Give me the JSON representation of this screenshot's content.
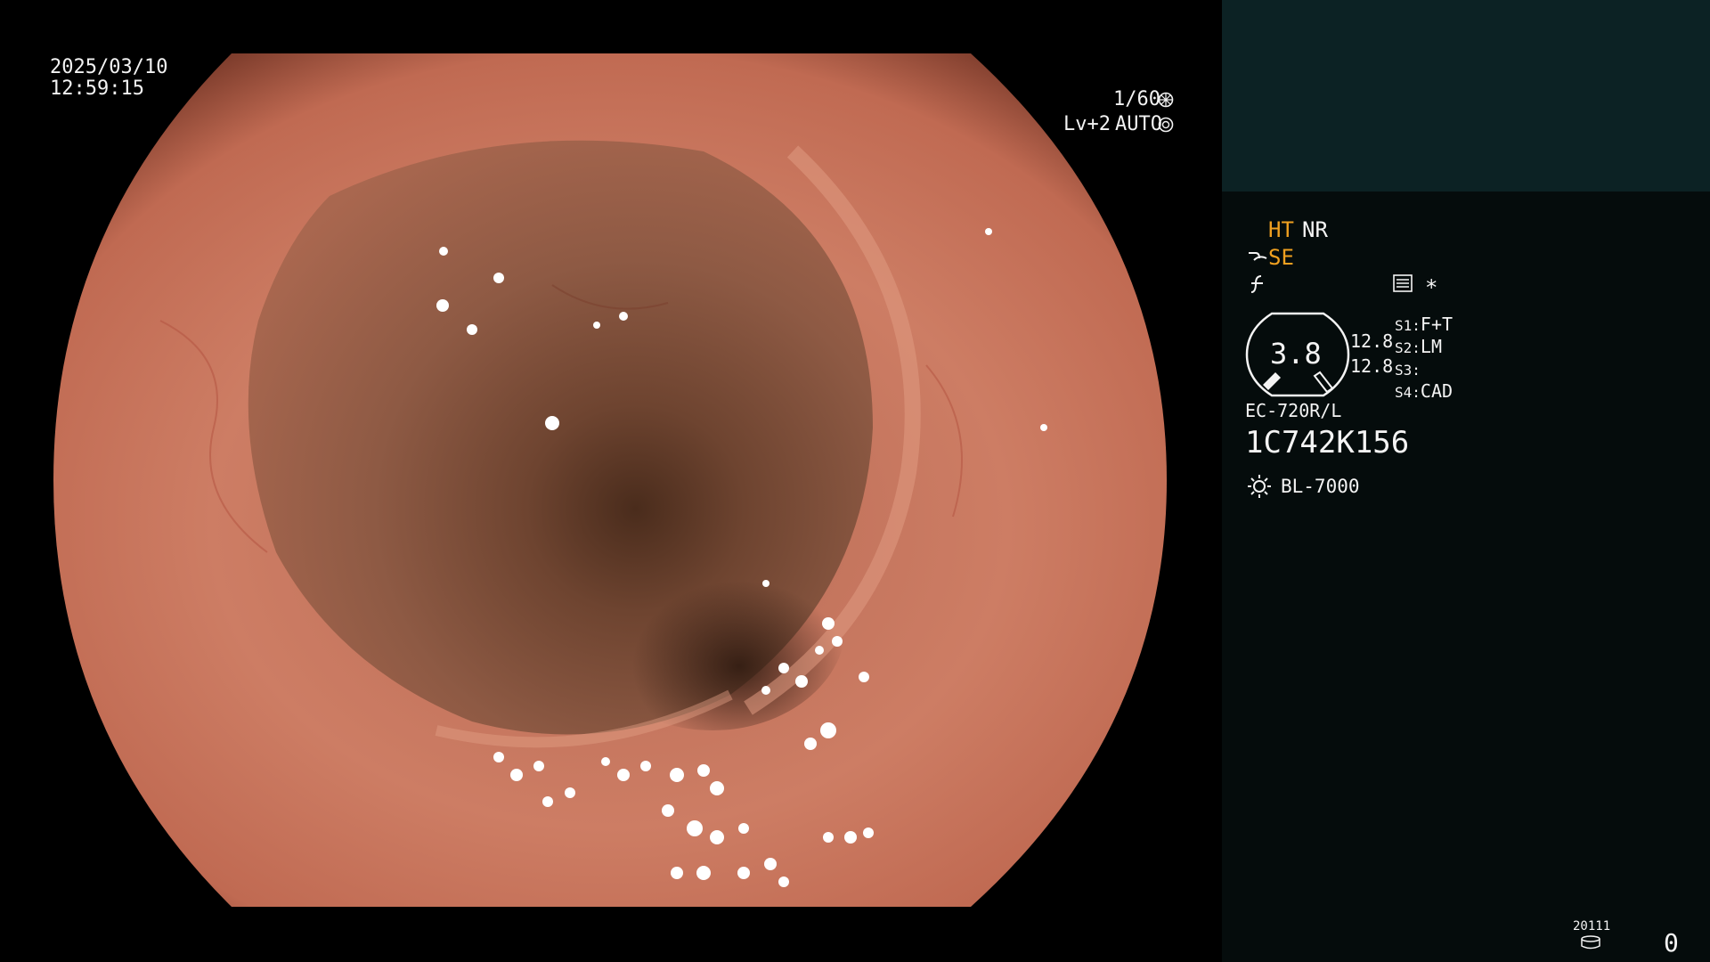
{
  "overlay": {
    "date": "2025/03/10",
    "time": "12:59:15",
    "shutter": "1/60",
    "level": "Lv+2",
    "iris_mode": "AUTO"
  },
  "panel": {
    "mode_ht": "HT",
    "mode_nr": "NR",
    "mode_se": "SE",
    "asterisk": "*",
    "gauge_value": "3.8",
    "gauge_side_1": "12.8",
    "gauge_side_2": "12.8",
    "switches": [
      {
        "key": "S1:",
        "value": "F+T"
      },
      {
        "key": "S2:",
        "value": "LM"
      },
      {
        "key": "S3:",
        "value": ""
      },
      {
        "key": "S4:",
        "value": "CAD"
      }
    ],
    "scope_model": "EC-720R/L",
    "scope_serial": "1C742K156",
    "light_source": "BL-7000",
    "record_code": "20111",
    "record_count": "0"
  },
  "colors": {
    "accent_orange": "#f0a020",
    "panel_top": "#0c2224",
    "panel_bg": "#050c0c",
    "tissue": "#c8755e"
  },
  "icons": [
    "shutter-icon",
    "iris-icon",
    "enhance-icon",
    "freeze-icon",
    "menu-icon",
    "light-source-icon",
    "storage-icon"
  ]
}
